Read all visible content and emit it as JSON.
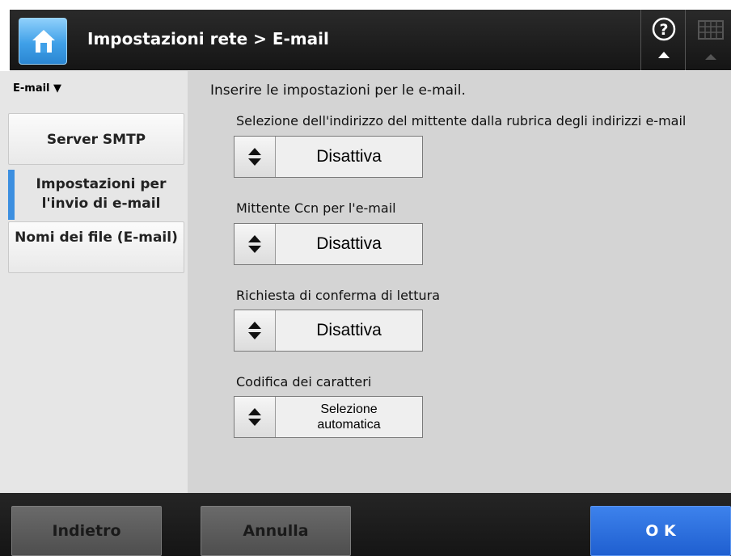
{
  "header": {
    "title": "Impostazioni rete > E-mail",
    "home_icon": "home-icon",
    "help_icon": "help-icon",
    "keyboard_icon": "keyboard-icon"
  },
  "sidebar": {
    "heading": "E-mail ▼",
    "items": [
      {
        "label": "Server SMTP",
        "state": "button"
      },
      {
        "label": "Impostazioni per l'invio di e-mail",
        "state": "selected"
      },
      {
        "label": "Nomi dei file (E-mail)",
        "state": "button"
      }
    ]
  },
  "main": {
    "intro": "Inserire le impostazioni per le e-mail.",
    "fields": [
      {
        "label": "Selezione dell'indirizzo del mittente dalla rubrica degli indirizzi e-mail",
        "value": "Disattiva"
      },
      {
        "label": "Mittente Ccn per l'e-mail",
        "value": "Disattiva"
      },
      {
        "label": "Richiesta di conferma di lettura",
        "value": "Disattiva"
      },
      {
        "label": "Codifica dei caratteri",
        "value": "Selezione automatica"
      }
    ]
  },
  "footer": {
    "back_label": "Indietro",
    "cancel_label": "Annulla",
    "ok_label": "O K"
  },
  "colors": {
    "accent": "#3d8fe0",
    "ok_button": "#2a6fde",
    "header_bg": "#1e1e1e",
    "content_bg": "#d4d4d4"
  }
}
